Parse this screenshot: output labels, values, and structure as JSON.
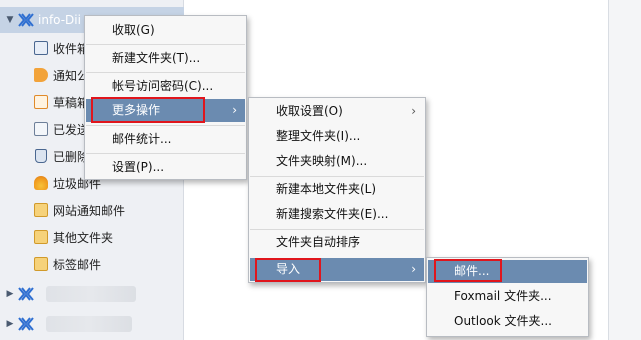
{
  "tree": {
    "account": "info-Dii",
    "folders": [
      {
        "label": "收件箱",
        "icon": "inbox-icon"
      },
      {
        "label": "通知公告",
        "icon": "megaphone-icon"
      },
      {
        "label": "草稿箱",
        "icon": "draft-icon"
      },
      {
        "label": "已发送",
        "icon": "sent-icon"
      },
      {
        "label": "已删除",
        "icon": "trash-icon"
      },
      {
        "label": "垃圾邮件",
        "icon": "spam-icon"
      },
      {
        "label": "网站通知邮件",
        "icon": "folder-icon"
      },
      {
        "label": "其他文件夹",
        "icon": "folder-icon"
      },
      {
        "label": "标签邮件",
        "icon": "tag-folder-icon"
      }
    ]
  },
  "menu1": {
    "items": [
      "收取(G)",
      "新建文件夹(T)...",
      "帐号访问密码(C)...",
      "更多操作",
      "邮件统计...",
      "设置(P)..."
    ]
  },
  "menu2": {
    "items": [
      "收取设置(O)",
      "整理文件夹(I)...",
      "文件夹映射(M)...",
      "新建本地文件夹(L)",
      "新建搜索文件夹(E)...",
      "文件夹自动排序",
      "导入"
    ]
  },
  "menu3": {
    "items": [
      "邮件...",
      "Foxmail 文件夹...",
      "Outlook 文件夹..."
    ]
  },
  "colors": {
    "highlight": "#6b8bb0",
    "annotation": "#e0151c",
    "selected_account": "#c5d3e5"
  }
}
